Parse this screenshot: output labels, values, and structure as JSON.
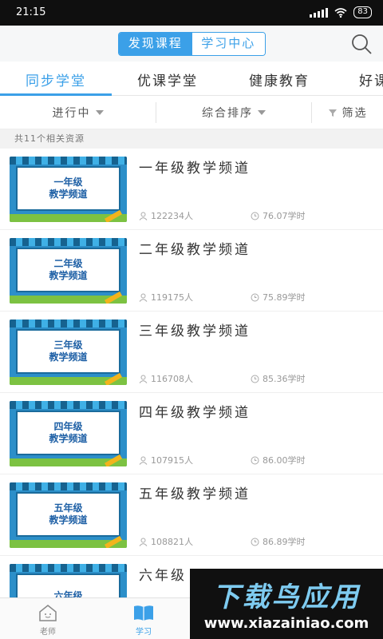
{
  "status_bar": {
    "time": "21:15",
    "battery": "83"
  },
  "header": {
    "segment": [
      "发现课程",
      "学习中心"
    ]
  },
  "tabs": [
    "同步学堂",
    "优课学堂",
    "健康教育",
    "好课"
  ],
  "filters": {
    "status": "进行中",
    "sort": "综合排序",
    "filter": "筛选"
  },
  "result_count": "共11个相关资源",
  "courses": [
    {
      "title": "一年级教学频道",
      "thumb_line1": "一年级",
      "thumb_line2": "教学频道",
      "learners": "122234人",
      "hours": "76.07学时"
    },
    {
      "title": "二年级教学频道",
      "thumb_line1": "二年级",
      "thumb_line2": "教学频道",
      "learners": "119175人",
      "hours": "75.89学时"
    },
    {
      "title": "三年级教学频道",
      "thumb_line1": "三年级",
      "thumb_line2": "教学频道",
      "learners": "116708人",
      "hours": "85.36学时"
    },
    {
      "title": "四年级教学频道",
      "thumb_line1": "四年级",
      "thumb_line2": "教学频道",
      "learners": "107915人",
      "hours": "86.00学时"
    },
    {
      "title": "五年级教学频道",
      "thumb_line1": "五年级",
      "thumb_line2": "教学频道",
      "learners": "108821人",
      "hours": "86.89学时"
    },
    {
      "title": "六年级",
      "thumb_line1": "六年级",
      "thumb_line2": "",
      "learners": "",
      "hours": ""
    }
  ],
  "bottom_nav": {
    "teacher": "老师",
    "study": "学习"
  },
  "watermark": {
    "title": "下载鸟应用",
    "url": "www.xiazainiao.com"
  },
  "colors": {
    "accent": "#3ba0e8"
  }
}
